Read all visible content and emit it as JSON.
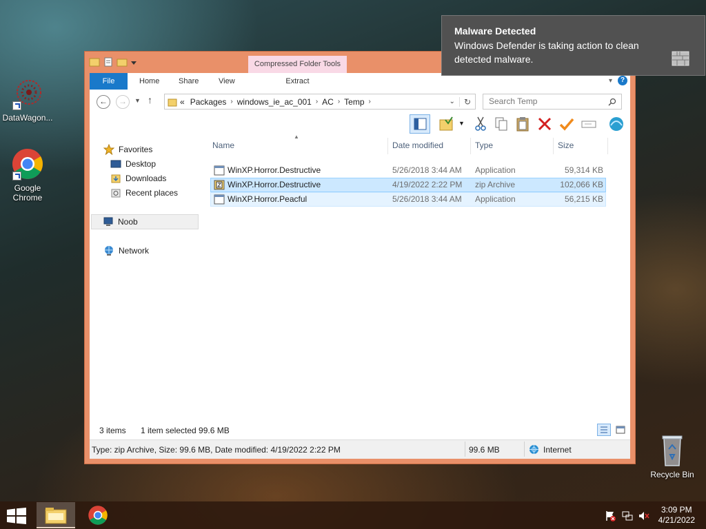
{
  "desktop": {
    "icons": [
      {
        "label": "DataWagon..."
      },
      {
        "label": "Google Chrome"
      },
      {
        "label": "Recycle Bin"
      }
    ]
  },
  "window": {
    "context_tab_header": "Compressed Folder Tools",
    "ribbon_tabs": [
      "File",
      "Home",
      "Share",
      "View",
      "Extract"
    ],
    "address": {
      "prefix": "«",
      "crumbs": [
        "Packages",
        "windows_ie_ac_001",
        "AC",
        "Temp"
      ]
    },
    "search_placeholder": "Search Temp",
    "nav": {
      "favorites": "Favorites",
      "desktop": "Desktop",
      "downloads": "Downloads",
      "recent": "Recent places",
      "computer": "Noob",
      "network": "Network"
    },
    "columns": {
      "name": "Name",
      "date": "Date modified",
      "type": "Type",
      "size": "Size"
    },
    "files": [
      {
        "name": "WinXP.Horror.Destructive",
        "date": "5/26/2018 3:44 AM",
        "type": "Application",
        "size": "59,314 KB"
      },
      {
        "name": "WinXP.Horror.Destructive",
        "date": "4/19/2022 2:22 PM",
        "type": "zip Archive",
        "size": "102,066 KB"
      },
      {
        "name": "WinXP.Horror.Peacful",
        "date": "5/26/2018 3:44 AM",
        "type": "Application",
        "size": "56,215 KB"
      }
    ],
    "status": {
      "items": "3 items",
      "selected": "1 item selected  99.6 MB"
    },
    "details": {
      "info": "Type: zip Archive, Size: 99.6 MB, Date modified: 4/19/2022 2:22 PM",
      "size": "99.6 MB",
      "zone": "Internet"
    }
  },
  "toast": {
    "title": "Malware Detected",
    "body": "Windows Defender is taking action to clean detected malware."
  },
  "taskbar": {
    "time": "3:09 PM",
    "date": "4/21/2022"
  },
  "colors": {
    "window_frame": "#e99069",
    "file_tab": "#1979ca",
    "context_tab": "#f9d9e6",
    "selection": "#cce8ff"
  }
}
